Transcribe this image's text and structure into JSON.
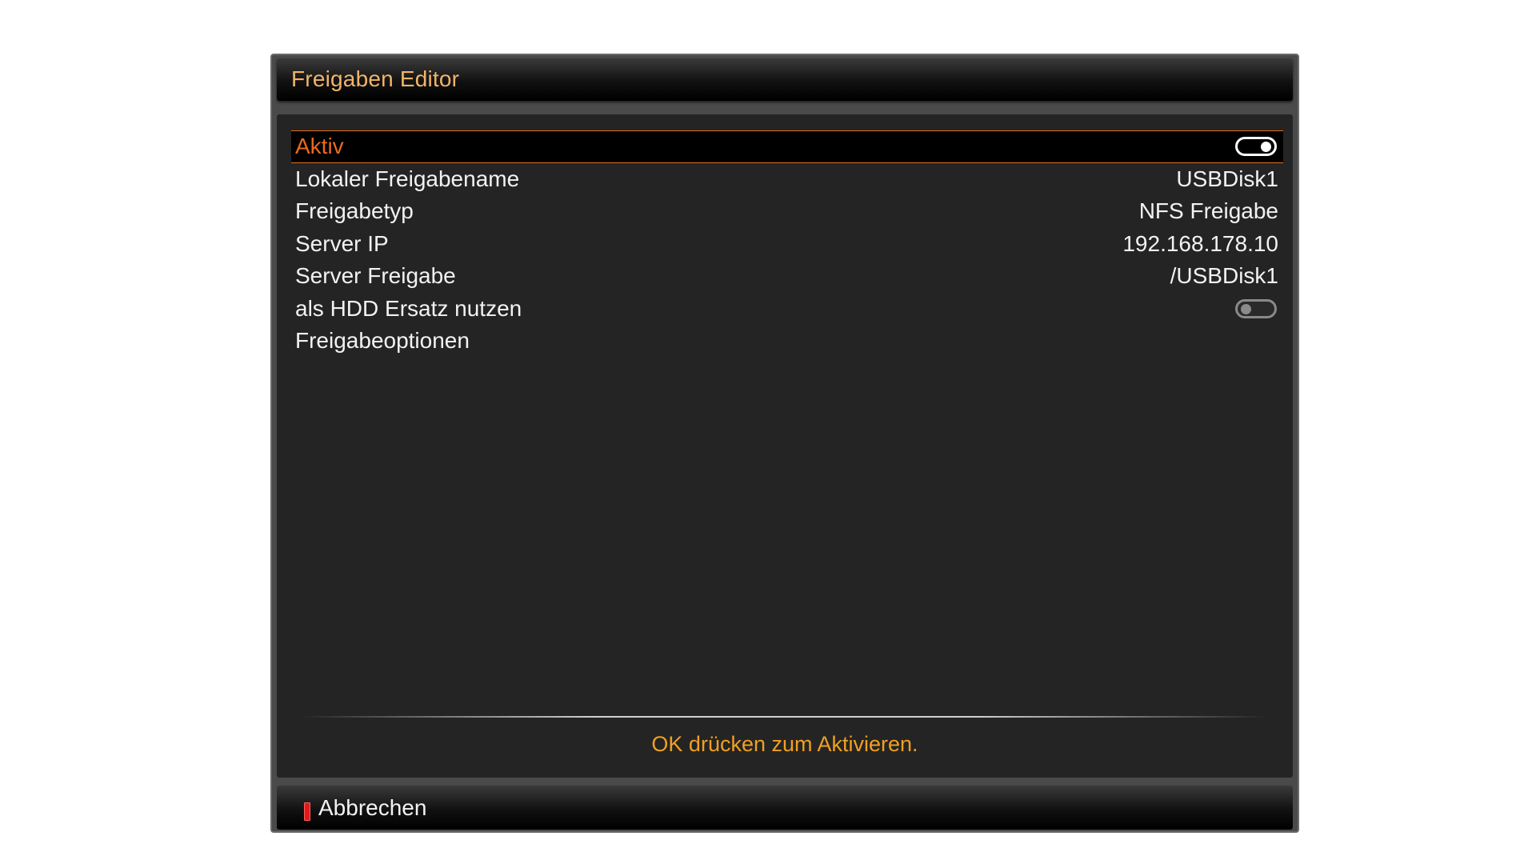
{
  "window": {
    "title": "Freigaben Editor"
  },
  "settings": {
    "rows": [
      {
        "label": "Aktiv",
        "type": "toggle",
        "checked": true,
        "selected": true
      },
      {
        "label": "Lokaler Freigabename",
        "value": "USBDisk1"
      },
      {
        "label": "Freigabetyp",
        "value": "NFS Freigabe"
      },
      {
        "label": "Server IP",
        "value": "192.168.178.10"
      },
      {
        "label": "Server Freigabe",
        "value": "/USBDisk1"
      },
      {
        "label": "als HDD Ersatz nutzen",
        "type": "toggle",
        "checked": false
      },
      {
        "label": "Freigabeoptionen",
        "value": ""
      }
    ]
  },
  "hint": "OK drücken zum Aktivieren.",
  "buttons": {
    "red": {
      "label": "Abbrechen",
      "color": "#e01a1a"
    }
  },
  "colors": {
    "title": "#f0b46a",
    "selected_text": "#e86a1e",
    "hint": "#f0a020"
  }
}
